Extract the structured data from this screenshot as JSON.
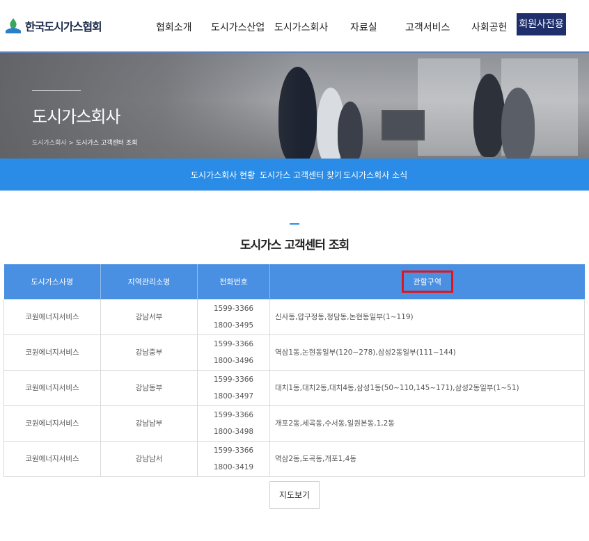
{
  "header": {
    "logo_text": "한국도시가스협회",
    "nav": [
      "협회소개",
      "도시가스산업",
      "도시가스회사",
      "자료실",
      "고객서비스",
      "사회공헌"
    ],
    "member_button": "회원사전용"
  },
  "hero": {
    "title": "도시가스회사",
    "breadcrumb_parent": "도시가스회사",
    "breadcrumb_sep": " > ",
    "breadcrumb_current": "도시가스 고객센터 조회"
  },
  "subnav": [
    "도시가스회사 현황",
    "도시가스 고객센터 찾기",
    "도시가스회사 소식"
  ],
  "section_title": "도시가스 고객센터 조회",
  "table": {
    "headers": [
      "도시가스사명",
      "지역관리소명",
      "전화번호",
      "관할구역"
    ],
    "rows": [
      {
        "company": "코원에너지서비스",
        "office": "강남서부",
        "phone1": "1599-3366",
        "phone2": "1800-3495",
        "area": "신사동,압구정동,청담동,논현동일부(1~119)"
      },
      {
        "company": "코원에너지서비스",
        "office": "강남중부",
        "phone1": "1599-3366",
        "phone2": "1800-3496",
        "area": "역삼1동,논현동일부(120~278),삼성2동일부(111~144)"
      },
      {
        "company": "코원에너지서비스",
        "office": "강남동부",
        "phone1": "1599-3366",
        "phone2": "1800-3497",
        "area": "대치1동,대치2동,대치4동,삼성1동(50~110,145~171),삼성2동일부(1~51)"
      },
      {
        "company": "코원에너지서비스",
        "office": "강남남부",
        "phone1": "1599-3366",
        "phone2": "1800-3498",
        "area": "개포2동,세곡동,수서동,일원본동,1,2동"
      },
      {
        "company": "코원에너지서비스",
        "office": "강남남서",
        "phone1": "1599-3366",
        "phone2": "1800-3419",
        "area": "역삼2동,도곡동,개포1,4동"
      }
    ]
  },
  "map_button": "지도보기",
  "colors": {
    "brand_navy": "#1e2f6b",
    "subnav_blue": "#2a8ce6",
    "table_header": "#4a90e2",
    "highlight": "#e0141c"
  }
}
